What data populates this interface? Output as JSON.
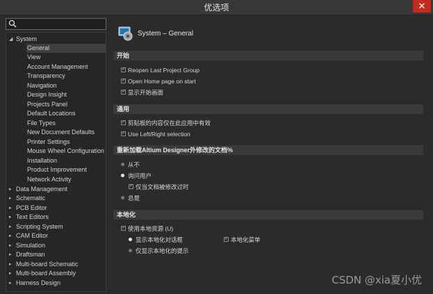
{
  "window": {
    "title": "优选项",
    "close_glyph": "✕"
  },
  "search": {
    "placeholder": "",
    "value": ""
  },
  "tree": {
    "root_expanded": {
      "label": "System",
      "arrow": "◢"
    },
    "children": [
      {
        "label": "General",
        "selected": true
      },
      {
        "label": "View"
      },
      {
        "label": "Account Management"
      },
      {
        "label": "Transparency"
      },
      {
        "label": "Navigation"
      },
      {
        "label": "Design Insight"
      },
      {
        "label": "Projects Panel"
      },
      {
        "label": "Default Locations"
      },
      {
        "label": "File Types"
      },
      {
        "label": "New Document Defaults"
      },
      {
        "label": "Printer Settings"
      },
      {
        "label": "Mouse Wheel Configuration"
      },
      {
        "label": "Installation"
      },
      {
        "label": "Product Improvement"
      },
      {
        "label": "Network Activity"
      }
    ],
    "collapsed": [
      {
        "label": "Data Management",
        "arrow": "▸"
      },
      {
        "label": "Schematic",
        "arrow": "▸"
      },
      {
        "label": "PCB Editor",
        "arrow": "▸"
      },
      {
        "label": "Text Editors",
        "arrow": "▸"
      },
      {
        "label": "Scripting System",
        "arrow": "▸"
      },
      {
        "label": "CAM Editor",
        "arrow": "▸"
      },
      {
        "label": "Simulation",
        "arrow": "▸"
      },
      {
        "label": "Draftsman",
        "arrow": "▸"
      },
      {
        "label": "Multi-board Schematic",
        "arrow": "▸"
      },
      {
        "label": "Multi-board Assembly",
        "arrow": "▸"
      },
      {
        "label": "Harness Design",
        "arrow": "▸"
      }
    ]
  },
  "page": {
    "title": "System – General",
    "icon": "system-settings-icon"
  },
  "sections": {
    "startup": {
      "title": "开始",
      "options": [
        {
          "label": "Reopen Last Project Group",
          "checked": true
        },
        {
          "label": "Open Home page on start",
          "checked": true
        },
        {
          "label": "显示开始画面",
          "checked": true
        }
      ]
    },
    "general": {
      "title": "通用",
      "options": [
        {
          "label": "剪贴板的内容仅在此应用中有效",
          "checked": true
        },
        {
          "label": "Use Left/Right selection",
          "checked": true
        }
      ]
    },
    "reload": {
      "title": "重新加载Altium Designer外修改的文档%",
      "options": [
        {
          "label": "从不",
          "selected": false
        },
        {
          "label": "询问用户",
          "selected": true
        },
        {
          "label": "仅当文档被修改过时",
          "checked": true
        },
        {
          "label": "总是",
          "selected": false
        }
      ]
    },
    "localization": {
      "title": "本地化",
      "use_local_resources": {
        "label": "使用本地资源 (U)",
        "checked": true
      },
      "show_localized_dialogs": {
        "label": "显示本地化对话框",
        "selected": true
      },
      "localized_menus": {
        "label": "本地化菜单",
        "checked": true
      },
      "show_localized_hints": {
        "label": "仅显示本地化的提示",
        "selected": false
      }
    }
  },
  "watermark": "CSDN @xia夏小优",
  "colors": {
    "close_button": "#c42b1c",
    "background": "#2b2b2b",
    "section_bar": "#3a3a3a"
  }
}
